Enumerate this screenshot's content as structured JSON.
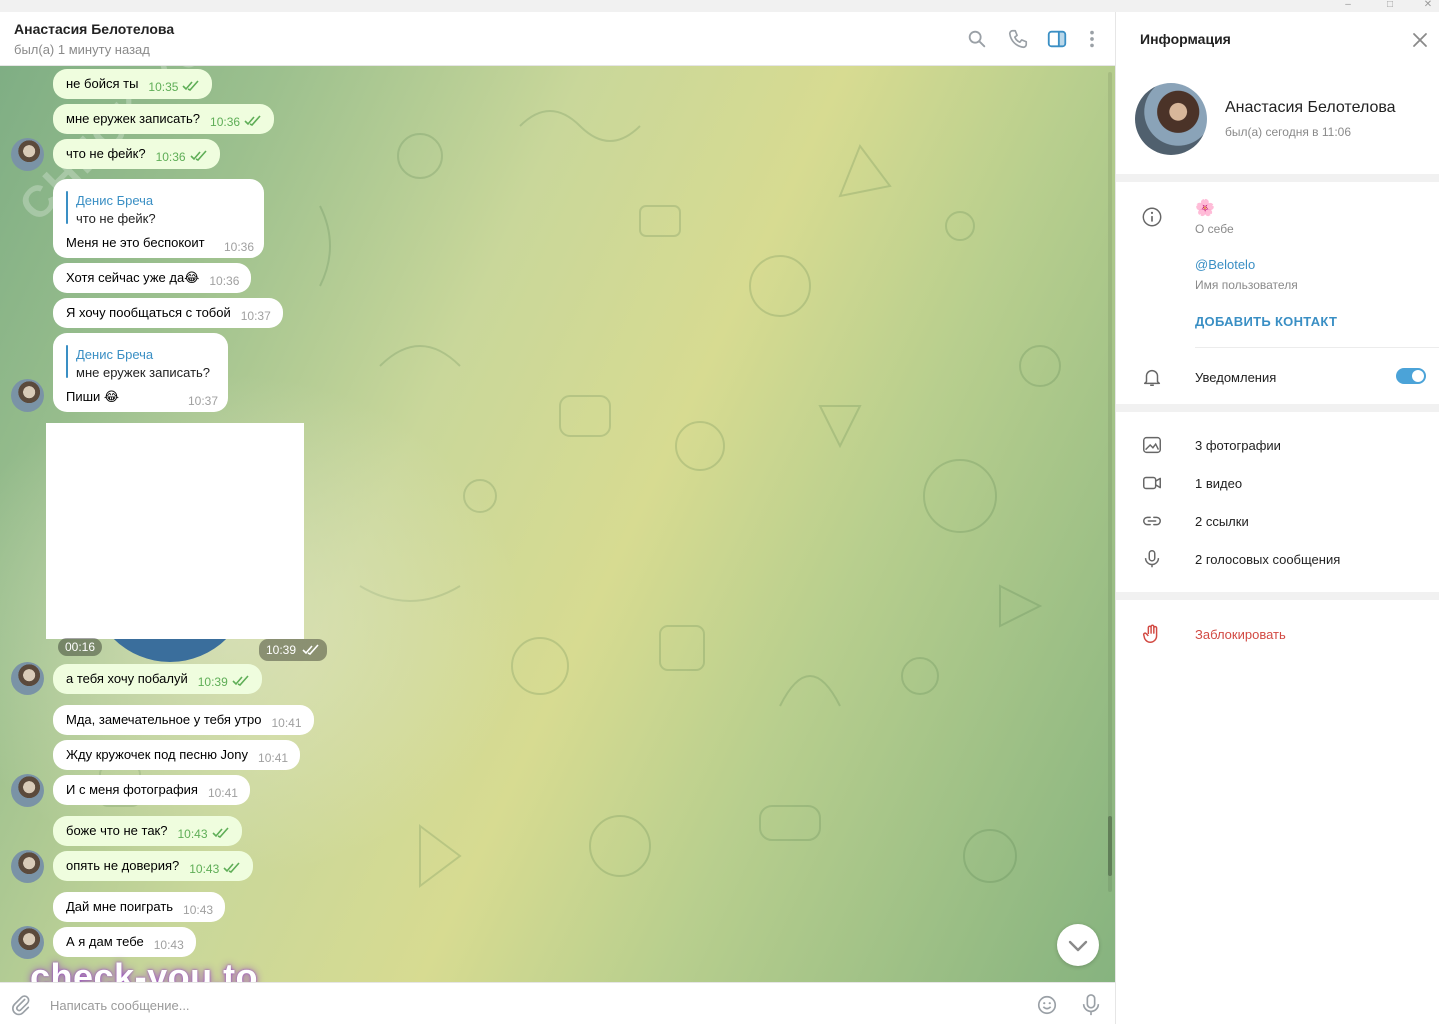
{
  "window": {
    "minimize": "–",
    "maximize": "□",
    "close": "✕"
  },
  "header": {
    "title": "Анастасия Белотелова",
    "status": "был(а) 1 минуту назад",
    "icons": [
      "search-icon",
      "phone-icon",
      "sidebar-icon",
      "more-icon"
    ]
  },
  "messages": [
    {
      "text": "не бойся ты",
      "time": "10:35",
      "type": "out"
    },
    {
      "text": "мне еружек записать?",
      "time": "10:36",
      "type": "out"
    },
    {
      "text": "что не фейк?",
      "time": "10:36",
      "type": "out"
    },
    {
      "reply_author": "Денис Бреча",
      "reply_text": "что не фейк?",
      "text": "Меня не это беспокоит",
      "time": "10:36",
      "type": "in"
    },
    {
      "text": "Хотя сейчас уже да😂",
      "time": "10:36",
      "type": "in"
    },
    {
      "text": "Я хочу пообщаться с тобой",
      "time": "10:37",
      "type": "in"
    },
    {
      "reply_author": "Денис Бреча",
      "reply_text": "мне еружек записать?",
      "text": "Пиши 😂",
      "time": "10:37",
      "type": "in"
    },
    {
      "video_duration": "00:16",
      "time": "10:39",
      "type": "out"
    },
    {
      "text": "а тебя хочу побалуй",
      "time": "10:39",
      "type": "out"
    },
    {
      "text": "Мда, замечательное у тебя утро",
      "time": "10:41",
      "type": "in"
    },
    {
      "text": "Жду кружочек под песню Jony",
      "time": "10:41",
      "type": "in"
    },
    {
      "text": "И с меня фотография",
      "time": "10:41",
      "type": "in"
    },
    {
      "text": "боже что не так?",
      "time": "10:43",
      "type": "out"
    },
    {
      "text": "опять не доверия?",
      "time": "10:43",
      "type": "out"
    },
    {
      "text": "Дай мне поиграть",
      "time": "10:43",
      "type": "in"
    },
    {
      "text": "А я дам тебе",
      "time": "10:43",
      "type": "in"
    }
  ],
  "watermark": {
    "main": "check-you.to",
    "diagonal": "CHECK YOU ME"
  },
  "input": {
    "placeholder": "Написать сообщение..."
  },
  "info": {
    "title": "Информация",
    "name": "Анастасия Белотелова",
    "status": "был(а) сегодня в 11:06",
    "bio_emoji": "🌸",
    "bio_label": "О себе",
    "username": "@Belotelo",
    "username_label": "Имя пользователя",
    "add_contact": "ДОБАВИТЬ КОНТАКТ",
    "notifications": "Уведомления",
    "notifications_on": true,
    "media": [
      {
        "label": "3 фотографии",
        "icon": "photo-icon"
      },
      {
        "label": "1 видео",
        "icon": "video-icon"
      },
      {
        "label": "2 ссылки",
        "icon": "link-icon"
      },
      {
        "label": "2 голосовых сообщения",
        "icon": "mic-icon"
      }
    ],
    "block": "Заблокировать",
    "colors": {
      "accent": "#3a8fc4",
      "danger": "#d24a43",
      "toggle": "#4ba3d8",
      "outgoing": "#effdde"
    }
  }
}
